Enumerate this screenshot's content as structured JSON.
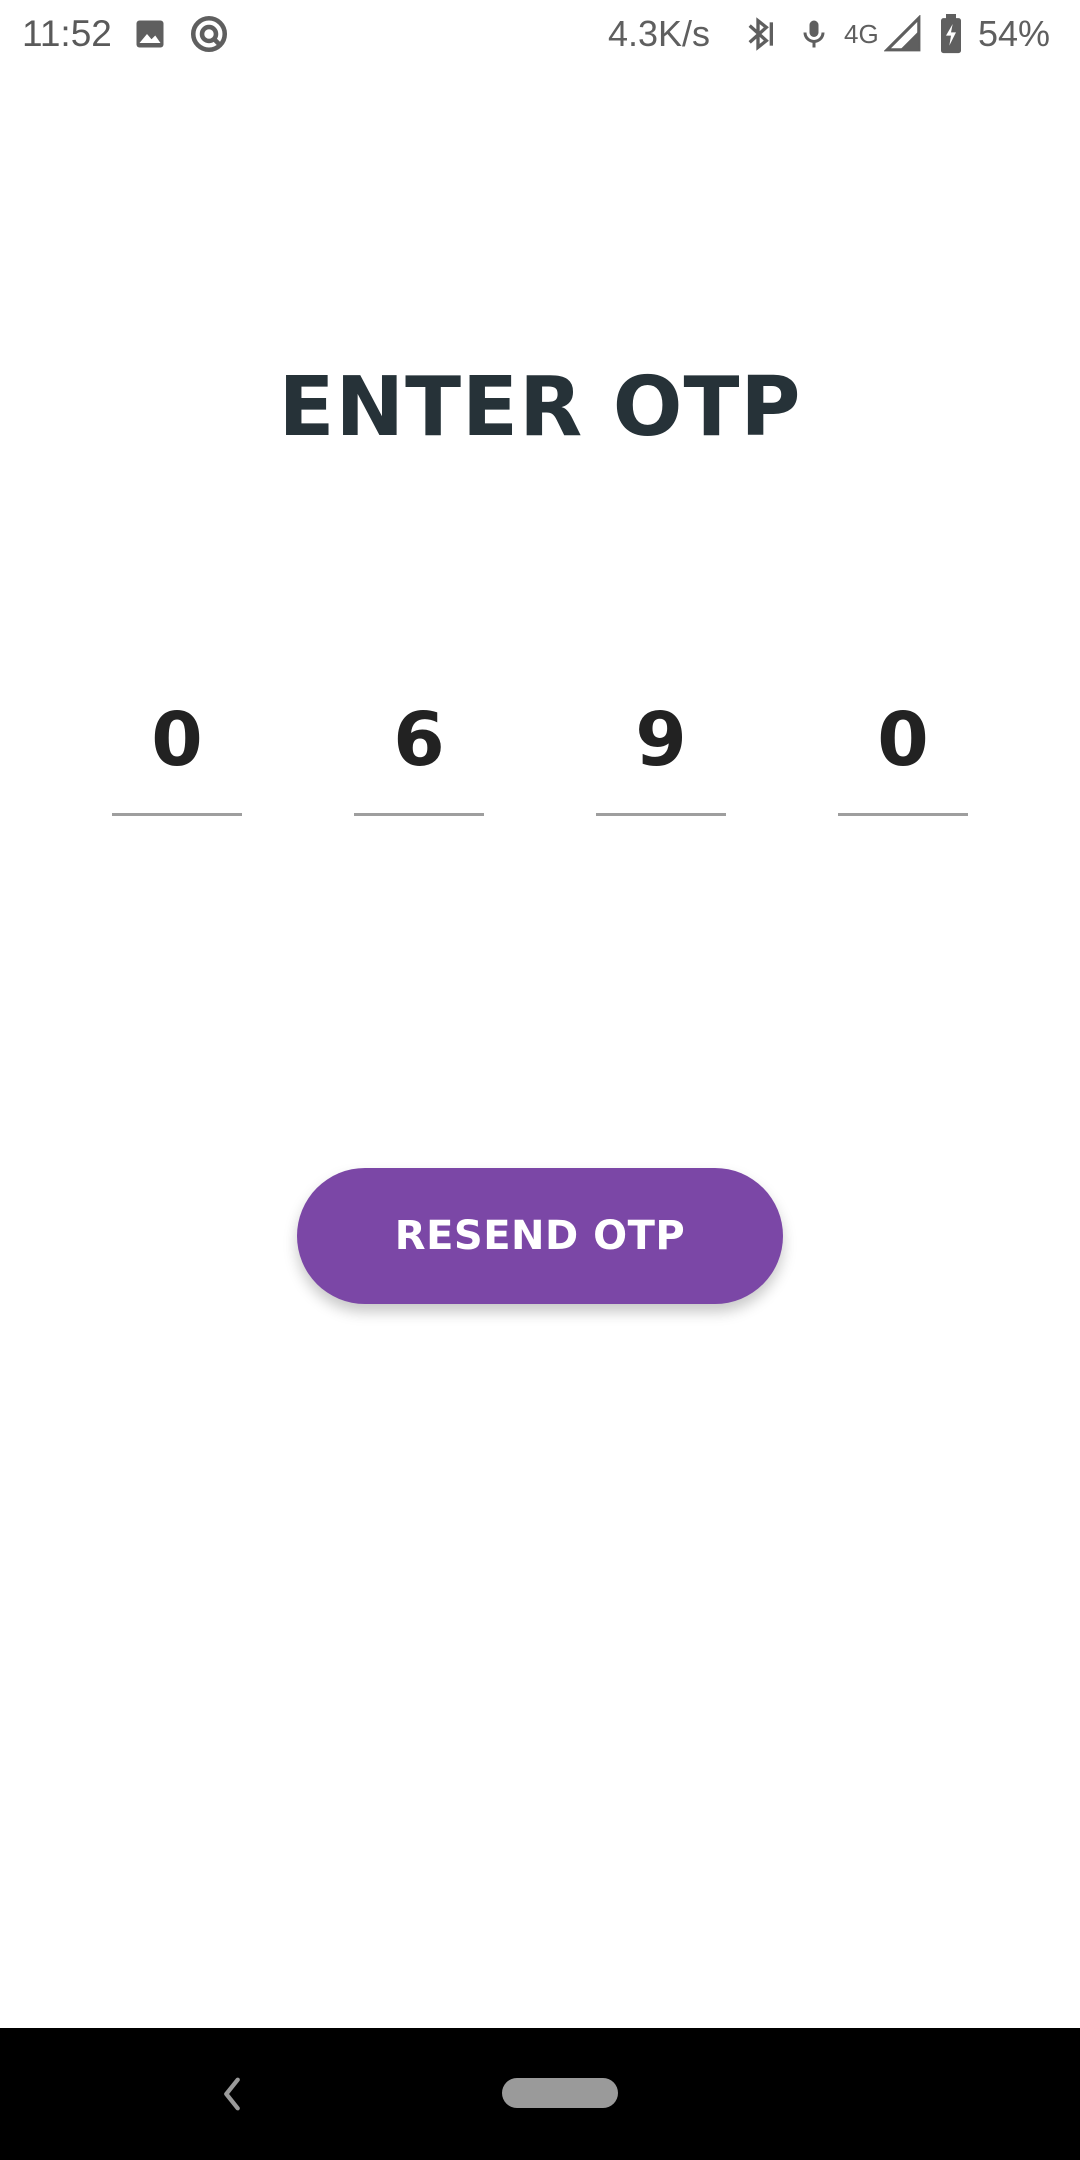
{
  "status_bar": {
    "time": "11:52",
    "net_speed": "4.3K/s",
    "network_type": "4G",
    "battery": "54%",
    "icons": [
      "gallery-icon",
      "sync-icon",
      "bluetooth-icon",
      "mic-icon",
      "signal-icon",
      "battery-charging-icon"
    ]
  },
  "page": {
    "title": "ENTER OTP"
  },
  "otp": {
    "digits": [
      "0",
      "6",
      "9",
      "0"
    ]
  },
  "actions": {
    "resend_label": "RESEND OTP"
  },
  "colors": {
    "accent": "#7b47a6",
    "title": "#263238",
    "digit": "#222222",
    "underline": "#9e9e9e"
  },
  "nav_bar": {
    "icons": [
      "back-icon",
      "home-pill-icon"
    ]
  }
}
